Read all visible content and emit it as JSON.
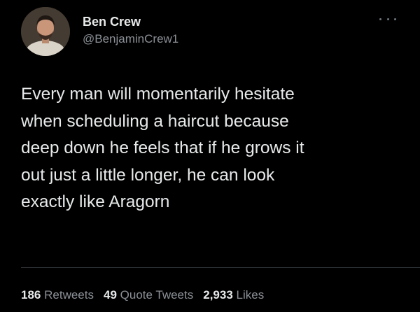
{
  "author": {
    "display_name": "Ben Crew",
    "handle": "@BenjaminCrew1"
  },
  "icons": {
    "more": "more-dots-icon"
  },
  "tweet": {
    "lines": [
      "Every man will momentarily hesitate",
      "when scheduling a haircut because",
      "deep down he feels that if he grows it",
      "out just a little longer, he can look",
      "exactly like Aragorn"
    ]
  },
  "stats": {
    "retweets_count": "186",
    "retweets_label": "Retweets",
    "quote_tweets_count": "49",
    "quote_tweets_label": "Quote Tweets",
    "likes_count": "2,933",
    "likes_label": "Likes"
  },
  "colors": {
    "background": "#000000",
    "primary_text": "#e7e9ea",
    "secondary_text": "#8b9096"
  }
}
